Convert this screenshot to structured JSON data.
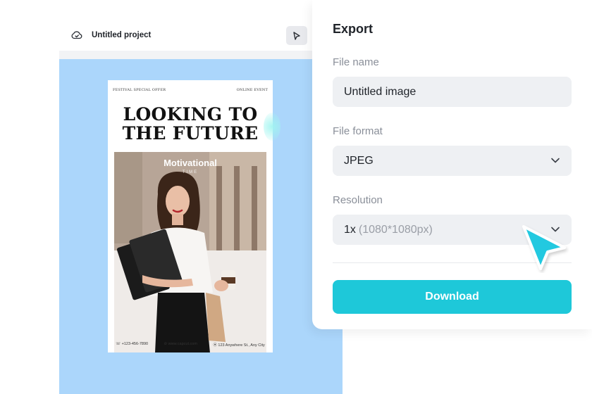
{
  "editor": {
    "project_title": "Untitled project"
  },
  "poster": {
    "top_left": "FESTIVAL SPECIAL OFFER",
    "top_right": "ONLINE EVENT",
    "headline_line1": "LOOKING TO",
    "headline_line2": "THE FUTURE",
    "badge": "Motivational",
    "badge_sub": "TIME",
    "phone": "+123-456-7890",
    "website": "www.capcut.com",
    "address": "123 Anywhere St., Any City"
  },
  "export": {
    "title": "Export",
    "file_name_label": "File name",
    "file_name_value": "Untitled image",
    "file_format_label": "File format",
    "file_format_value": "JPEG",
    "resolution_label": "Resolution",
    "resolution_value": "1x",
    "resolution_detail": "(1080*1080px)",
    "download_label": "Download"
  },
  "colors": {
    "accent": "#1ec8d9",
    "canvas_bg": "#abd6fb",
    "pointer": "#23c9e0"
  }
}
